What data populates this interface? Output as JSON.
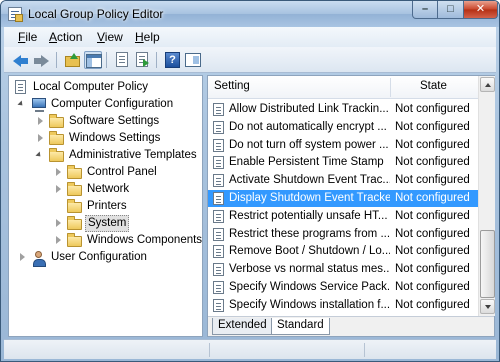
{
  "window": {
    "title": "Local Group Policy Editor"
  },
  "window_controls": {
    "minimize": "–",
    "maximize": "□",
    "close": "✕"
  },
  "menu": [
    {
      "key": "F",
      "rest": "ile"
    },
    {
      "key": "A",
      "rest": "ction"
    },
    {
      "key": "V",
      "rest": "iew"
    },
    {
      "key": "H",
      "rest": "elp"
    }
  ],
  "toolbar": {
    "help_glyph": "?"
  },
  "tree": {
    "root": "Local Computer Policy",
    "computer_config": "Computer Configuration",
    "software_settings": "Software Settings",
    "windows_settings": "Windows Settings",
    "admin_templates": "Administrative Templates",
    "control_panel": "Control Panel",
    "network": "Network",
    "printers": "Printers",
    "system": "System",
    "windows_components": "Windows Components",
    "user_config": "User Configuration"
  },
  "list": {
    "columns": {
      "setting": "Setting",
      "state": "State"
    },
    "rows": [
      {
        "setting": "Allow Distributed Link Trackin...",
        "state": "Not configured"
      },
      {
        "setting": "Do not automatically encrypt ...",
        "state": "Not configured"
      },
      {
        "setting": "Do not turn off system power ...",
        "state": "Not configured"
      },
      {
        "setting": "Enable Persistent Time Stamp",
        "state": "Not configured"
      },
      {
        "setting": "Activate Shutdown Event Trac...",
        "state": "Not configured"
      },
      {
        "setting": "Display Shutdown Event Tracker",
        "state": "Not configured"
      },
      {
        "setting": "Restrict potentially unsafe HT...",
        "state": "Not configured"
      },
      {
        "setting": "Restrict these programs from ...",
        "state": "Not configured"
      },
      {
        "setting": "Remove Boot / Shutdown / Lo...",
        "state": "Not configured"
      },
      {
        "setting": "Verbose vs normal status mes...",
        "state": "Not configured"
      },
      {
        "setting": "Specify Windows Service Pack...",
        "state": "Not configured"
      },
      {
        "setting": "Specify Windows installation f...",
        "state": "Not configured"
      }
    ],
    "selected_index": 5
  },
  "tabs": {
    "extended": "Extended",
    "standard": "Standard",
    "active": "standard"
  },
  "colors": {
    "selection": "#3399ff",
    "titlebar": "#a9c4e2",
    "folder": "#eec95c"
  }
}
